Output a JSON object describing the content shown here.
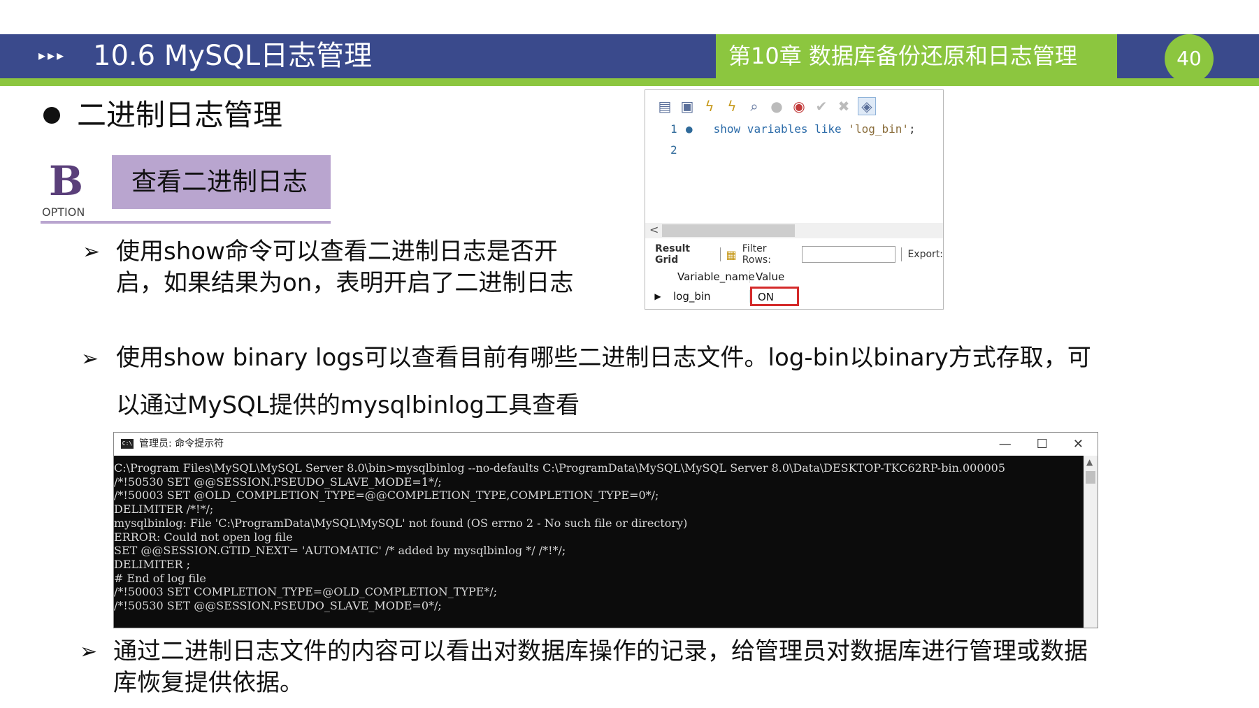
{
  "header": {
    "triangles": "▸▸▸",
    "title": "10.6  MySQL日志管理",
    "chapter": "第10章   数据库备份还原和日志管理",
    "page_number": "40"
  },
  "section": {
    "title": "二进制日志管理"
  },
  "option": {
    "letter": "B",
    "label": "OPTION",
    "box_text": "查看二进制日志"
  },
  "bullets": [
    {
      "lines": [
        "使用show命令可以查看二进制日志是否开",
        "启，如果结果为on，表明开启了二进制日志"
      ]
    },
    {
      "lines": [
        "使用show binary logs可以查看目前有哪些二进制日志文件。log-bin以binary方式存取，可",
        "以通过MySQL提供的mysqlbinlog工具查看"
      ]
    },
    {
      "lines": [
        "通过二进制日志文件的内容可以看出对数据库操作的记录，给管理员对数据库进行管理或数据",
        "库恢复提供依据。"
      ]
    }
  ],
  "arrow_glyph": "➢",
  "query": {
    "line1_num": "1",
    "line1_dot": "●",
    "line1_kw": "show variables like",
    "line1_str": "'log_bin'",
    "line1_end": ";",
    "line2_num": "2",
    "scroll_left": "<",
    "result_grid": "Result Grid",
    "filter_rows": "Filter Rows:",
    "export": "Export:",
    "col1": "Variable_name",
    "col2": "Value",
    "row_marker": "▶",
    "row_name": "log_bin",
    "row_value": "ON"
  },
  "cmd": {
    "icon_text": "C:\\",
    "title": "管理员: 命令提示符",
    "minimize": "—",
    "maximize": "☐",
    "close": "✕",
    "scroll_up": "▲",
    "lines": [
      "C:\\Program Files\\MySQL\\MySQL Server 8.0\\bin>mysqlbinlog --no-defaults C:\\ProgramData\\MySQL\\MySQL Server 8.0\\Data\\DESKTOP-TKC62RP-bin.000005",
      "/*!50530 SET @@SESSION.PSEUDO_SLAVE_MODE=1*/;",
      "/*!50003 SET @OLD_COMPLETION_TYPE=@@COMPLETION_TYPE,COMPLETION_TYPE=0*/;",
      "DELIMITER /*!*/;",
      "mysqlbinlog: File 'C:\\ProgramData\\MySQL\\MySQL' not found (OS errno 2 - No such file or directory)",
      "ERROR: Could not open log file",
      "SET @@SESSION.GTID_NEXT= 'AUTOMATIC' /* added by mysqlbinlog */ /*!*/;",
      "DELIMITER ;",
      "# End of log file",
      "/*!50003 SET COMPLETION_TYPE=@OLD_COMPLETION_TYPE*/;",
      "/*!50530 SET @@SESSION.PSEUDO_SLAVE_MODE=0*/;"
    ]
  },
  "icons": {
    "toolbar": [
      "folder-icon",
      "save-icon",
      "execute-icon",
      "execute-current-icon",
      "explain-icon",
      "stop-icon",
      "toggle-icon",
      "commit-icon",
      "rollback-icon",
      "autocommit-icon"
    ]
  },
  "colors": {
    "header_blue": "#3a4a8c",
    "accent_green": "#8cc63f",
    "option_purple": "#b9a5cf",
    "highlight_red": "#d42a2a"
  }
}
